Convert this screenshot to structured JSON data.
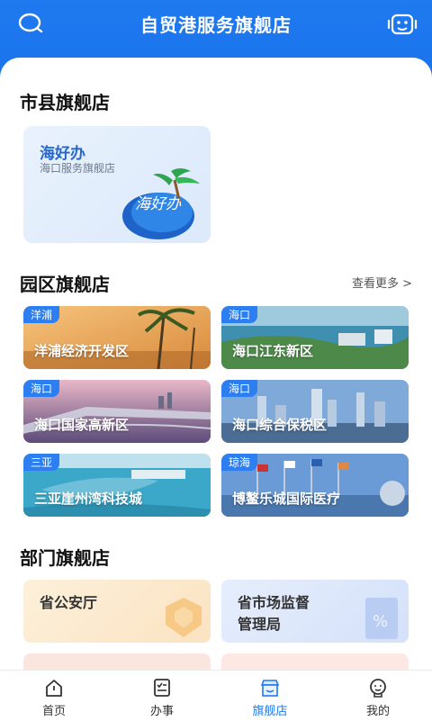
{
  "header": {
    "title": "自贸港服务旗舰店"
  },
  "sections": {
    "city": {
      "title": "市县旗舰店"
    },
    "park": {
      "title": "园区旗舰店",
      "more": "查看更多 >"
    },
    "dept": {
      "title": "部门旗舰店"
    }
  },
  "city_card": {
    "name": "海好办",
    "sub": "海口服务旗舰店",
    "logo_text": "海好办"
  },
  "parks": [
    {
      "tag": "洋浦",
      "label": "洋浦经济开发区"
    },
    {
      "tag": "海口",
      "label": "海口江东新区"
    },
    {
      "tag": "海口",
      "label": "海口国家高新区"
    },
    {
      "tag": "海口",
      "label": "海口综合保税区"
    },
    {
      "tag": "三亚",
      "label": "三亚崖州湾科技城"
    },
    {
      "tag": "琼海",
      "label": "博鳌乐城国际医疗"
    }
  ],
  "depts": [
    {
      "name": "省公安厅"
    },
    {
      "name": "省市场监督\n管理局"
    }
  ],
  "nav": [
    {
      "label": "首页",
      "icon": "home-icon"
    },
    {
      "label": "办事",
      "icon": "task-icon"
    },
    {
      "label": "旗舰店",
      "icon": "store-icon",
      "active": true
    },
    {
      "label": "我的",
      "icon": "profile-icon"
    }
  ],
  "colors": {
    "primary": "#1f79ef",
    "tag": "#2d7ff1"
  }
}
